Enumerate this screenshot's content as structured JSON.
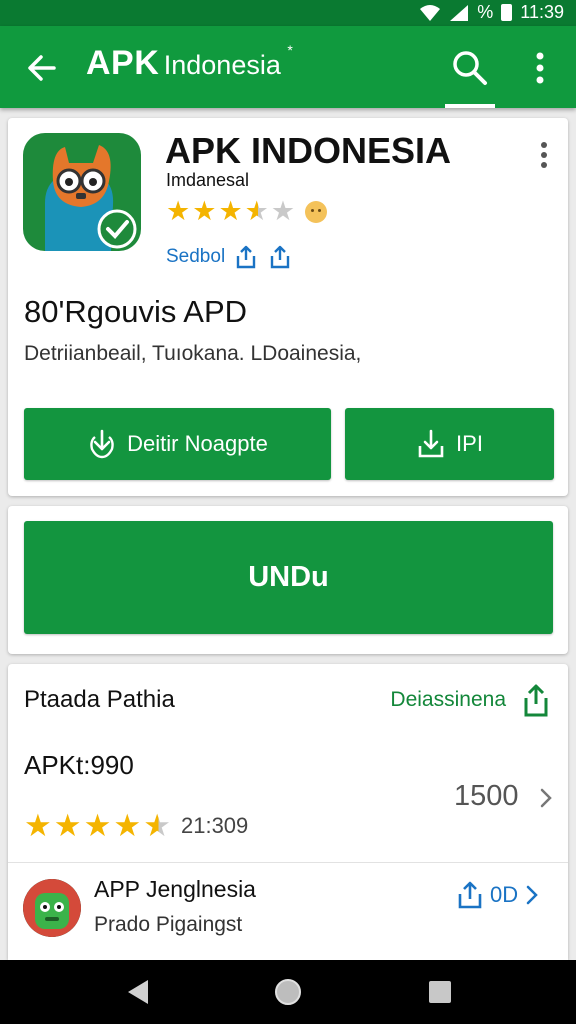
{
  "status_bar": {
    "time": "11:39",
    "battery_percent_icon": "%"
  },
  "appbar": {
    "title_main": "APK",
    "title_sub": "Indonesia",
    "title_star": "*",
    "icons": [
      "back-arrow-icon",
      "search-icon",
      "more-vert-icon"
    ]
  },
  "app": {
    "name": "APK INDONESIA",
    "developer": "Imdanesal",
    "rating": 3.5,
    "share_label": "Sedbol",
    "headline": "80'Rgouvis APD",
    "description": "Detriianbeail, Tuıokana. LDoainesia,",
    "button_left": "Deitir Noagpte",
    "button_right": "IPI"
  },
  "download": {
    "label": "UNDu"
  },
  "section": {
    "title": "Ptaada Pathia",
    "link": "Deiassinena",
    "price": "APKt:990",
    "rating": 4.5,
    "rating_count": "21:309",
    "size": "1500"
  },
  "list_item": {
    "title": "APP Jenglnesia",
    "subtitle": "Prado Pigaingst",
    "action": "0D"
  },
  "colors": {
    "primary": "#109a3e",
    "primary_dark": "#0a7a31",
    "button": "#13953f",
    "star": "#f4b400",
    "link_blue": "#1a73c4"
  }
}
